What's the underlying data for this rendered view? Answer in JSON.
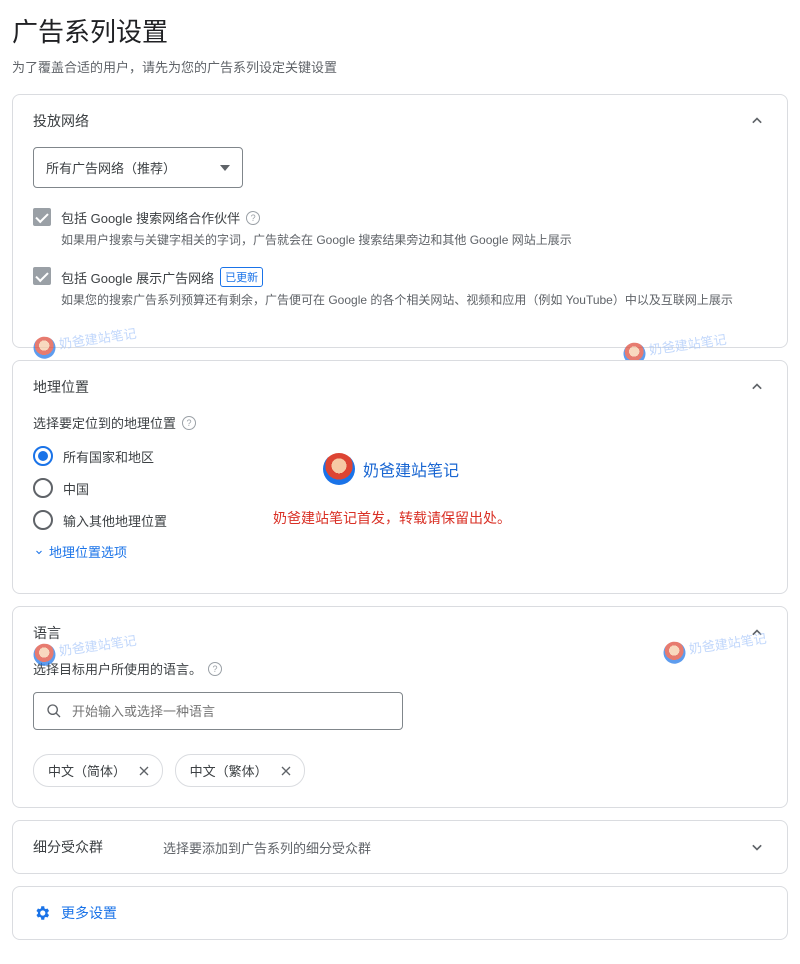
{
  "page": {
    "title": "广告系列设置",
    "subtitle": "为了覆盖合适的用户，请先为您的广告系列设定关键设置"
  },
  "networks": {
    "header": "投放网络",
    "dropdown_selected": "所有广告网络（推荐）",
    "opt1_label": "包括 Google 搜索网络合作伙伴",
    "opt1_desc": "如果用户搜索与关键字相关的字词，广告就会在 Google 搜索结果旁边和其他 Google 网站上展示",
    "opt2_label": "包括 Google 展示广告网络",
    "opt2_badge": "已更新",
    "opt2_desc": "如果您的搜索广告系列预算还有剩余，广告便可在 Google 的各个相关网站、视频和应用（例如 YouTube）中以及互联网上展示"
  },
  "locations": {
    "header": "地理位置",
    "section_label": "选择要定位到的地理位置",
    "radio1": "所有国家和地区",
    "radio2": "中国",
    "radio3": "输入其他地理位置",
    "expand_link": "地理位置选项"
  },
  "watermark": {
    "brand": "奶爸建站笔记",
    "note": "奶爸建站笔记首发，转载请保留出处。"
  },
  "languages": {
    "header": "语言",
    "section_label": "选择目标用户所使用的语言。",
    "placeholder": "开始输入或选择一种语言",
    "chips": [
      "中文（简体）",
      "中文（繁体）"
    ]
  },
  "audiences": {
    "header": "细分受众群",
    "desc": "选择要添加到广告系列的细分受众群"
  },
  "more_settings": "更多设置"
}
